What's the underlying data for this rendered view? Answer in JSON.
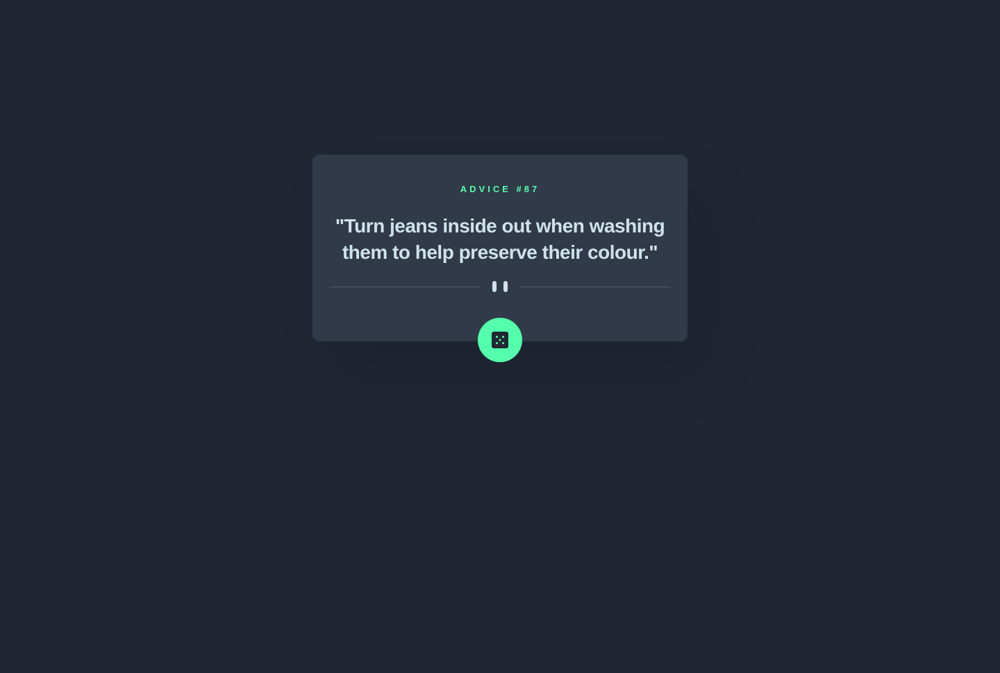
{
  "advice": {
    "id_label": "ADVICE #87",
    "text": "\"Turn jeans inside out when washing them to help preserve their colour.\""
  },
  "divider": {
    "icon": "pause-icon"
  },
  "button": {
    "icon": "dice-icon"
  },
  "colors": {
    "background": "#202733",
    "card": "#313A48",
    "accent": "#53FFAA",
    "text": "#CEE3E9",
    "divider_line": "#4F5D74"
  }
}
